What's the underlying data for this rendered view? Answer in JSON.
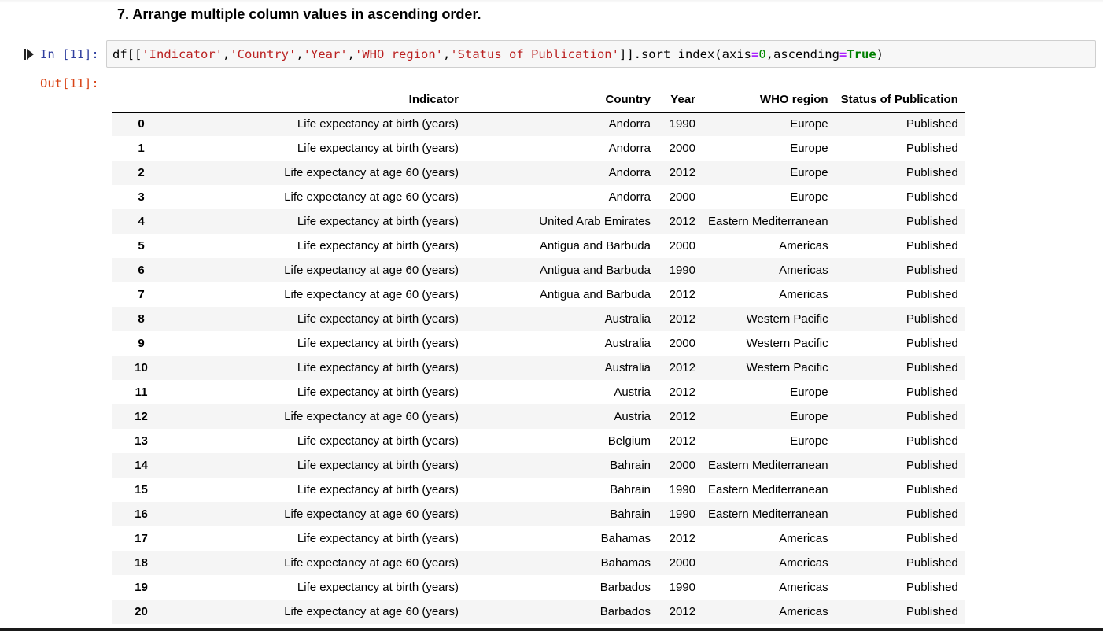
{
  "section": {
    "heading": "7. Arrange multiple column values in ascending order."
  },
  "cell": {
    "in_prompt": "In [11]:",
    "out_prompt": "Out[11]:",
    "code": {
      "t1": "df[[",
      "t2": "'Indicator'",
      "t3": ",",
      "t4": "'Country'",
      "t5": ",",
      "t6": "'Year'",
      "t7": ",",
      "t8": "'WHO region'",
      "t9": ",",
      "t10": "'Status of Publication'",
      "t11": "]].sort_index(axis",
      "t12": "=",
      "t13": "0",
      "t14": ",ascending",
      "t15": "=",
      "t16": "True",
      "t17": ")"
    }
  },
  "table": {
    "columns": [
      "",
      "Indicator",
      "Country",
      "Year",
      "WHO region",
      "Status of Publication"
    ],
    "rows": [
      [
        "0",
        "Life expectancy at birth (years)",
        "Andorra",
        "1990",
        "Europe",
        "Published"
      ],
      [
        "1",
        "Life expectancy at birth (years)",
        "Andorra",
        "2000",
        "Europe",
        "Published"
      ],
      [
        "2",
        "Life expectancy at age 60 (years)",
        "Andorra",
        "2012",
        "Europe",
        "Published"
      ],
      [
        "3",
        "Life expectancy at age 60 (years)",
        "Andorra",
        "2000",
        "Europe",
        "Published"
      ],
      [
        "4",
        "Life expectancy at birth (years)",
        "United Arab Emirates",
        "2012",
        "Eastern Mediterranean",
        "Published"
      ],
      [
        "5",
        "Life expectancy at birth (years)",
        "Antigua and Barbuda",
        "2000",
        "Americas",
        "Published"
      ],
      [
        "6",
        "Life expectancy at age 60 (years)",
        "Antigua and Barbuda",
        "1990",
        "Americas",
        "Published"
      ],
      [
        "7",
        "Life expectancy at age 60 (years)",
        "Antigua and Barbuda",
        "2012",
        "Americas",
        "Published"
      ],
      [
        "8",
        "Life expectancy at birth (years)",
        "Australia",
        "2012",
        "Western Pacific",
        "Published"
      ],
      [
        "9",
        "Life expectancy at birth (years)",
        "Australia",
        "2000",
        "Western Pacific",
        "Published"
      ],
      [
        "10",
        "Life expectancy at birth (years)",
        "Australia",
        "2012",
        "Western Pacific",
        "Published"
      ],
      [
        "11",
        "Life expectancy at birth (years)",
        "Austria",
        "2012",
        "Europe",
        "Published"
      ],
      [
        "12",
        "Life expectancy at age 60 (years)",
        "Austria",
        "2012",
        "Europe",
        "Published"
      ],
      [
        "13",
        "Life expectancy at birth (years)",
        "Belgium",
        "2012",
        "Europe",
        "Published"
      ],
      [
        "14",
        "Life expectancy at birth (years)",
        "Bahrain",
        "2000",
        "Eastern Mediterranean",
        "Published"
      ],
      [
        "15",
        "Life expectancy at birth (years)",
        "Bahrain",
        "1990",
        "Eastern Mediterranean",
        "Published"
      ],
      [
        "16",
        "Life expectancy at age 60 (years)",
        "Bahrain",
        "1990",
        "Eastern Mediterranean",
        "Published"
      ],
      [
        "17",
        "Life expectancy at birth (years)",
        "Bahamas",
        "2012",
        "Americas",
        "Published"
      ],
      [
        "18",
        "Life expectancy at age 60 (years)",
        "Bahamas",
        "2000",
        "Americas",
        "Published"
      ],
      [
        "19",
        "Life expectancy at birth (years)",
        "Barbados",
        "1990",
        "Americas",
        "Published"
      ],
      [
        "20",
        "Life expectancy at age 60 (years)",
        "Barbados",
        "2012",
        "Americas",
        "Published"
      ]
    ]
  },
  "icons": {
    "run": "run-cell-icon"
  },
  "colors": {
    "prompt_in": "#303f9f",
    "prompt_out": "#d84315",
    "string": "#ba2121",
    "number": "#008800",
    "keyword": "#008000",
    "operator": "#aa22ff"
  }
}
